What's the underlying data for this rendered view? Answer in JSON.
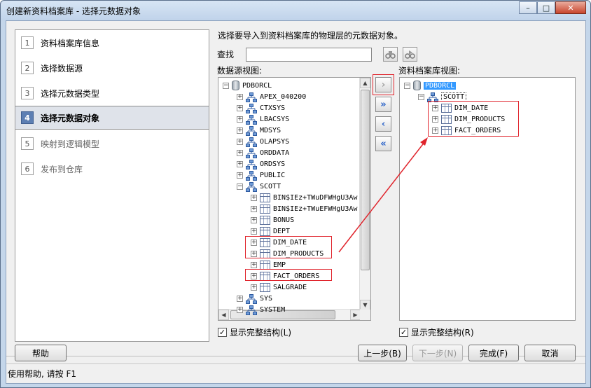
{
  "window": {
    "title": "创建新资料档案库 - 选择元数据对象",
    "minimize_glyph": "–",
    "maximize_glyph": "□",
    "close_glyph": "✕"
  },
  "steps": [
    {
      "num": "1",
      "label": "资料档案库信息",
      "state": "done"
    },
    {
      "num": "2",
      "label": "选择数据源",
      "state": "done"
    },
    {
      "num": "3",
      "label": "选择元数据类型",
      "state": "done"
    },
    {
      "num": "4",
      "label": "选择元数据对象",
      "state": "active"
    },
    {
      "num": "5",
      "label": "映射到逻辑模型",
      "state": "todo"
    },
    {
      "num": "6",
      "label": "发布到仓库",
      "state": "todo"
    }
  ],
  "instruction": "选择要导入到资料档案库的物理层的元数据对象。",
  "find": {
    "label": "查找",
    "value": "",
    "find_icon": "binoculars-icon",
    "find_next_icon": "binoculars-next-icon"
  },
  "source": {
    "label": "数据源视图:",
    "nodes": [
      {
        "text": "PDBORCL",
        "icon": "db",
        "exp": "−",
        "level": 0
      },
      {
        "text": "APEX_040200",
        "icon": "schema",
        "exp": "+",
        "level": 1
      },
      {
        "text": "CTXSYS",
        "icon": "schema",
        "exp": "+",
        "level": 1
      },
      {
        "text": "LBACSYS",
        "icon": "schema",
        "exp": "+",
        "level": 1
      },
      {
        "text": "MDSYS",
        "icon": "schema",
        "exp": "+",
        "level": 1
      },
      {
        "text": "OLAPSYS",
        "icon": "schema",
        "exp": "+",
        "level": 1
      },
      {
        "text": "ORDDATA",
        "icon": "schema",
        "exp": "+",
        "level": 1
      },
      {
        "text": "ORDSYS",
        "icon": "schema",
        "exp": "+",
        "level": 1
      },
      {
        "text": "PUBLIC",
        "icon": "schema",
        "exp": "+",
        "level": 1
      },
      {
        "text": "SCOTT",
        "icon": "schema",
        "exp": "−",
        "level": 1
      },
      {
        "text": "BIN$IEz+TWuDFWHgU3Aw",
        "icon": "table",
        "exp": "+",
        "level": 2
      },
      {
        "text": "BIN$IEz+TWuEFWHgU3Aw",
        "icon": "table",
        "exp": "+",
        "level": 2
      },
      {
        "text": "BONUS",
        "icon": "table",
        "exp": "+",
        "level": 2
      },
      {
        "text": "DEPT",
        "icon": "table",
        "exp": "+",
        "level": 2
      },
      {
        "text": "DIM_DATE",
        "icon": "table",
        "exp": "+",
        "level": 2
      },
      {
        "text": "DIM_PRODUCTS",
        "icon": "table",
        "exp": "+",
        "level": 2
      },
      {
        "text": "EMP",
        "icon": "table",
        "exp": "+",
        "level": 2
      },
      {
        "text": "FACT_ORDERS",
        "icon": "table",
        "exp": "+",
        "level": 2
      },
      {
        "text": "SALGRADE",
        "icon": "table",
        "exp": "+",
        "level": 2
      },
      {
        "text": "SYS",
        "icon": "schema",
        "exp": "+",
        "level": 1
      },
      {
        "text": "SYSTEM",
        "icon": "schema",
        "exp": "+",
        "level": 1
      }
    ]
  },
  "target": {
    "label": "资料档案库视图:",
    "nodes": [
      {
        "text": "PDBORCL",
        "icon": "db",
        "exp": "−",
        "level": 0,
        "style": "sel"
      },
      {
        "text": "SCOTT",
        "icon": "schema",
        "exp": "−",
        "level": 1,
        "style": "dotted"
      },
      {
        "text": "DIM_DATE",
        "icon": "table",
        "exp": "+",
        "level": 2
      },
      {
        "text": "DIM_PRODUCTS",
        "icon": "table",
        "exp": "+",
        "level": 2
      },
      {
        "text": "FACT_ORDERS",
        "icon": "table",
        "exp": "+",
        "level": 2
      }
    ]
  },
  "move_buttons": [
    {
      "glyph": "›",
      "name": "import-selected-button",
      "disabled": true
    },
    {
      "glyph": "»",
      "name": "import-all-button",
      "disabled": false
    },
    {
      "glyph": "‹",
      "name": "remove-selected-button",
      "disabled": false
    },
    {
      "glyph": "«",
      "name": "remove-all-button",
      "disabled": false
    }
  ],
  "show_full_structure": "显示完整结构(L)",
  "show_full_structure_right": "显示完整结构(R)",
  "buttons": {
    "help": "帮助",
    "back": "上一步(B)",
    "next": "下一步(N)",
    "finish": "完成(F)",
    "cancel": "取消"
  },
  "status_text": "使用帮助, 请按 F1",
  "colors": {
    "highlight_red": "#e0242c",
    "selection_blue": "#3399ff"
  }
}
